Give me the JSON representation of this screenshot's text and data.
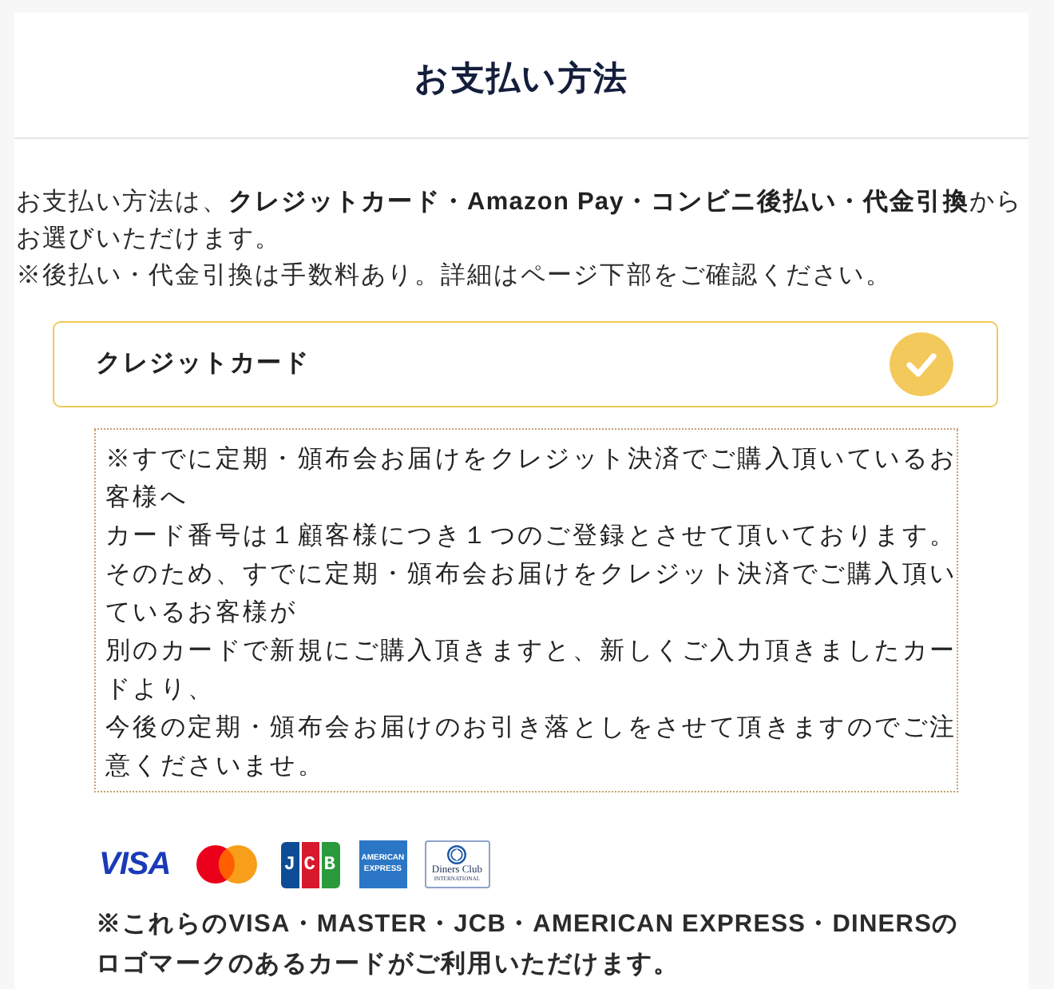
{
  "page": {
    "title": "お支払い方法"
  },
  "intro": {
    "lines": [
      "お支払い方法は、**クレジットカード・Amazon Pay・コンビニ後払い・代金引換**から",
      "お選びいただけます。",
      "※後払い・代金引換は手数料あり。詳細はページ下部をご確認ください。"
    ]
  },
  "payment_options": [
    {
      "label": "クレジットカード",
      "selected": true
    }
  ],
  "notice": {
    "lines": [
      "※すでに定期・頒布会お届けをクレジット決済でご購入頂いているお",
      "客様へ",
      "カード番号は１顧客様につき１つのご登録とさせて頂いております。",
      "そのため、すでに定期・頒布会お届けをクレジット決済でご購入頂い",
      "ているお客様が",
      "別のカードで新規にご購入頂きますと、新しくご入力頂きましたカー",
      "ドより、",
      "今後の定期・頒布会お届けのお引き落としをさせて頂きますのでご注",
      "意くださいませ。"
    ]
  },
  "card_logos": [
    {
      "kind": "visa",
      "text": "VISA"
    },
    {
      "kind": "mastercard"
    },
    {
      "kind": "jcb",
      "text": "JCB"
    },
    {
      "kind": "amex",
      "text": "AMERICAN EXPRESS"
    },
    {
      "kind": "diners",
      "text": "Diners Club",
      "subtext": "INTERNATIONAL"
    }
  ],
  "card_note": {
    "lines": [
      "※これらのVISA・MASTER・JCB・AMERICAN EXPRESS・DINERSの",
      "ロゴマークのあるカードがご利用いただけます。"
    ]
  }
}
